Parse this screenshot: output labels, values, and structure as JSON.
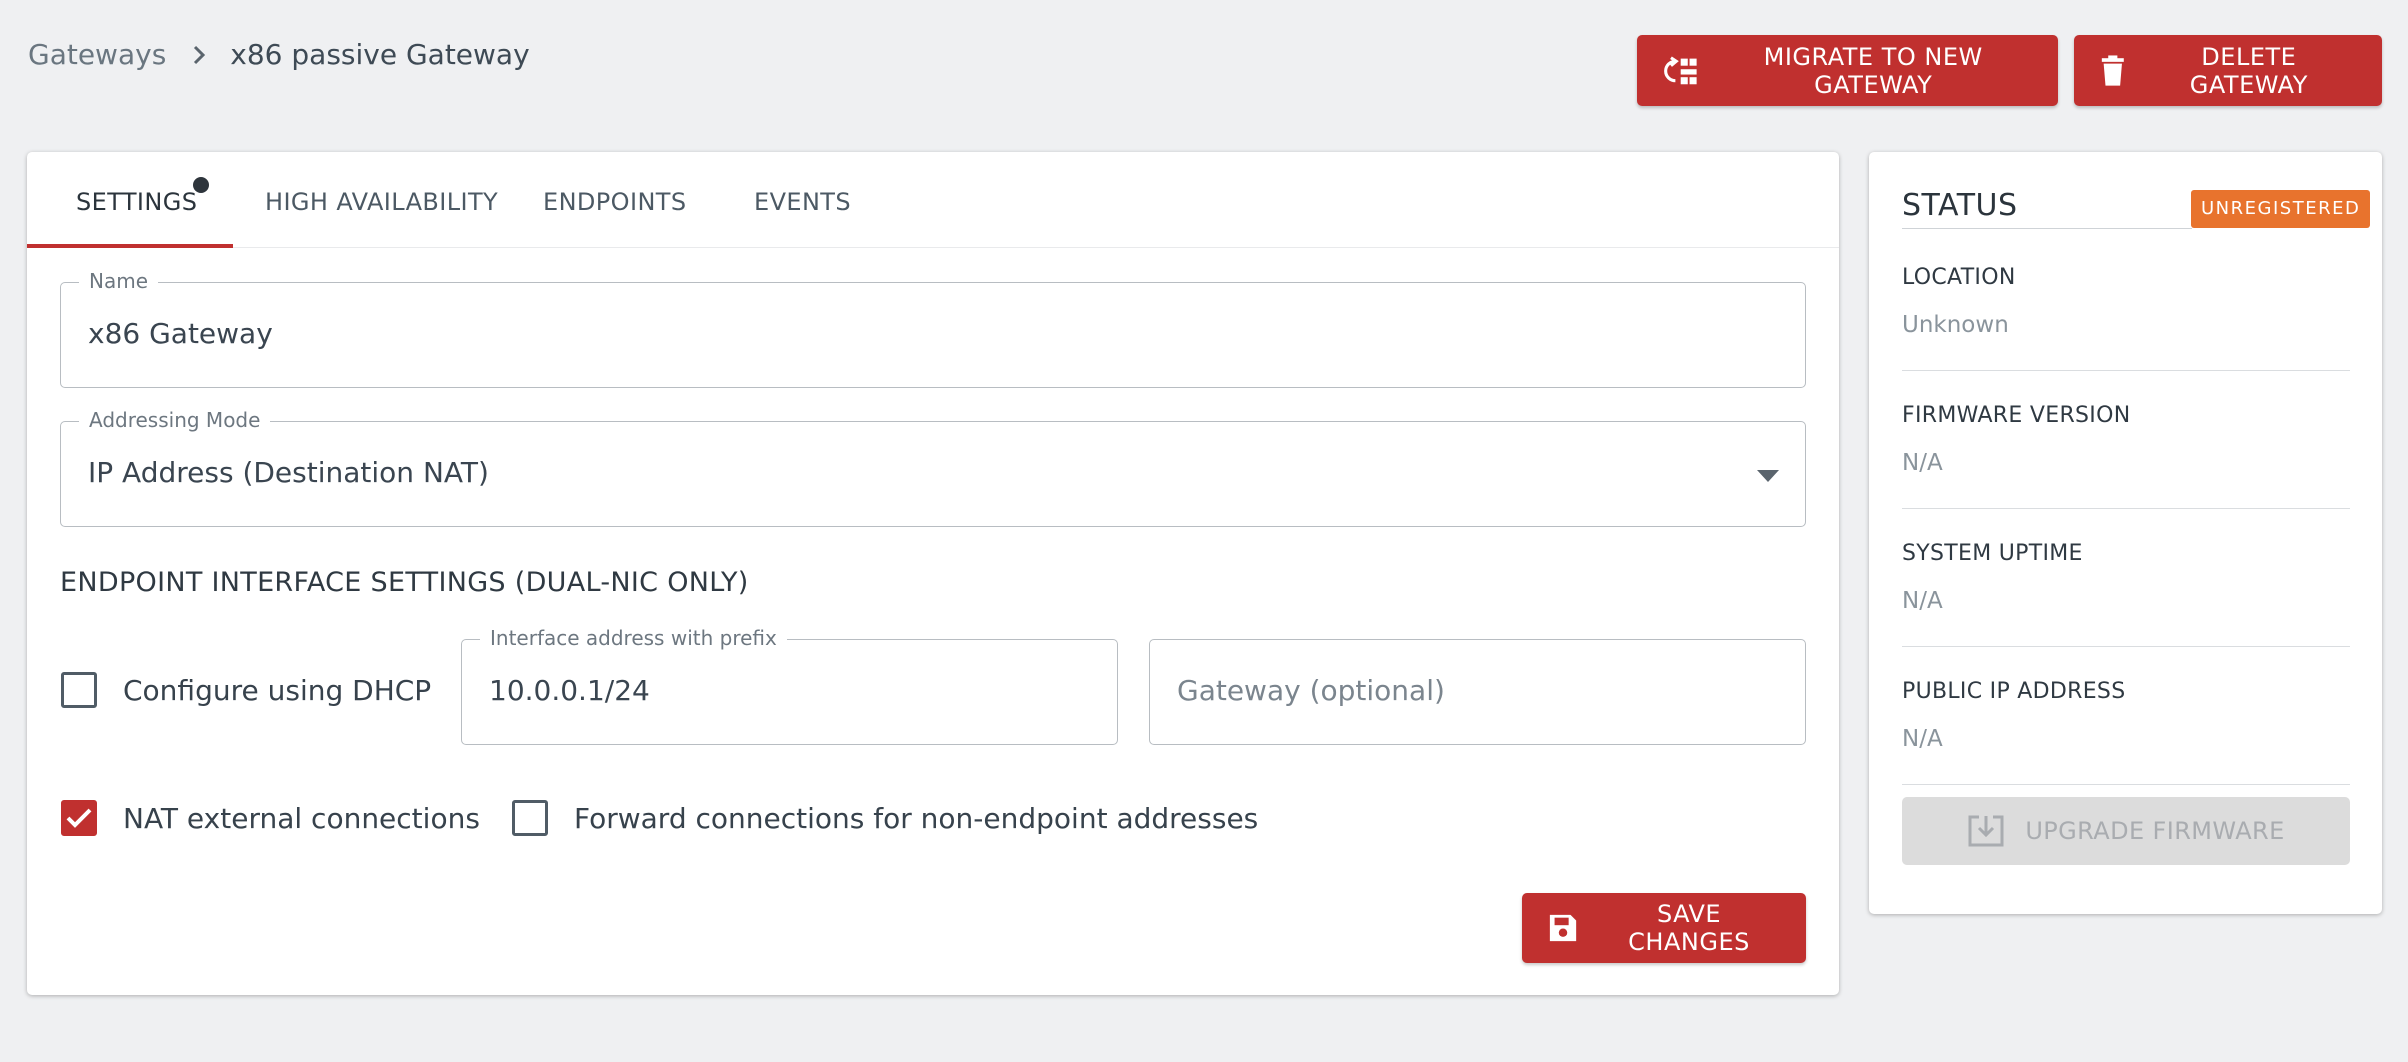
{
  "breadcrumb": {
    "parent": "Gateways",
    "current": "x86 passive Gateway"
  },
  "actions": {
    "migrate_label": "MIGRATE TO NEW GATEWAY",
    "delete_label": "DELETE GATEWAY"
  },
  "tabs": [
    {
      "label": "SETTINGS",
      "active": true
    },
    {
      "label": "HIGH AVAILABILITY",
      "active": false
    },
    {
      "label": "ENDPOINTS",
      "active": false
    },
    {
      "label": "EVENTS",
      "active": false
    }
  ],
  "settings": {
    "name": {
      "label": "Name",
      "value": "x86 Gateway"
    },
    "addressing_mode": {
      "label": "Addressing Mode",
      "value": "IP Address (Destination NAT)"
    },
    "endpoint_section_title": "ENDPOINT INTERFACE SETTINGS (DUAL-NIC ONLY)",
    "dhcp": {
      "label": "Configure using DHCP",
      "checked": false
    },
    "interface_address": {
      "label": "Interface address with prefix",
      "value": "10.0.0.1/24"
    },
    "gateway": {
      "placeholder": "Gateway (optional)"
    },
    "nat_external": {
      "label": "NAT external connections",
      "checked": true
    },
    "forward_non_endpoint": {
      "label": "Forward connections for non-endpoint addresses",
      "checked": false
    },
    "save_label": "SAVE CHANGES"
  },
  "status": {
    "title": "STATUS",
    "badge": "UNREGISTERED",
    "items": [
      {
        "label": "LOCATION",
        "value": "Unknown"
      },
      {
        "label": "FIRMWARE VERSION",
        "value": "N/A"
      },
      {
        "label": "SYSTEM UPTIME",
        "value": "N/A"
      },
      {
        "label": "PUBLIC IP ADDRESS",
        "value": "N/A"
      }
    ],
    "upgrade_label": "UPGRADE FIRMWARE"
  },
  "colors": {
    "accent": "#c0302f",
    "badge": "#e8732d",
    "background": "#eff0f2"
  },
  "icons": {
    "breadcrumb_separator": "chevron-right-icon",
    "migrate": "swap-icon",
    "delete": "trash-icon",
    "save": "floppy-disk-icon",
    "upgrade": "download-tray-icon",
    "dropdown": "caret-down-icon",
    "check": "check-icon"
  }
}
